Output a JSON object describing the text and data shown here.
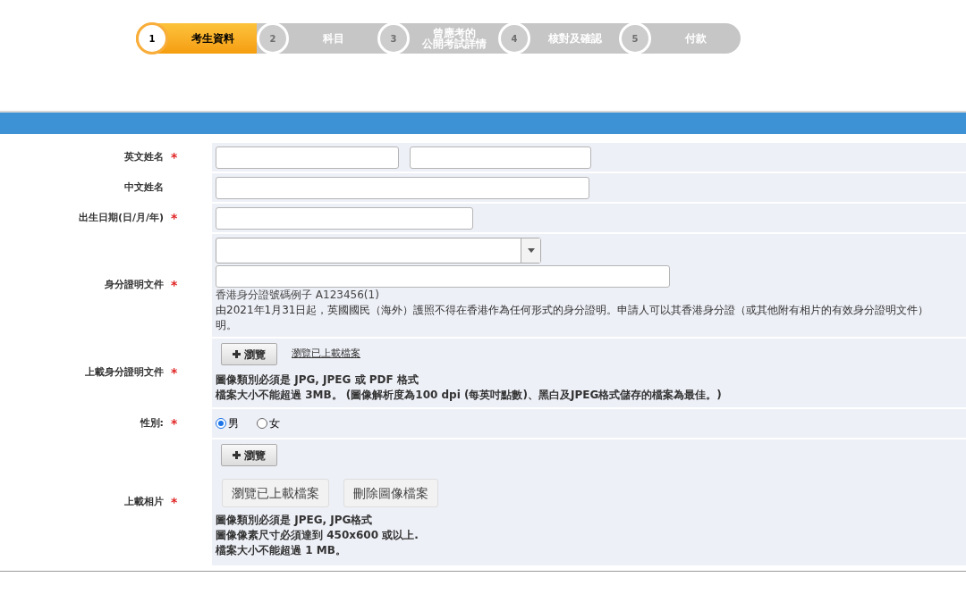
{
  "steps": [
    {
      "number": "1",
      "label": "考生資料",
      "selected": true
    },
    {
      "number": "2",
      "label": "科目",
      "selected": false
    },
    {
      "number": "3",
      "label_lines": [
        "曾應考的",
        "公開考試詳情"
      ],
      "selected": false
    },
    {
      "number": "4",
      "label": "核對及確認",
      "selected": false
    },
    {
      "number": "5",
      "label": "付款",
      "selected": false
    }
  ],
  "form_rows": [
    {
      "label": "英文姓名",
      "required": true,
      "kind": "two_inputs"
    },
    {
      "label": "中文姓名",
      "required": false,
      "kind": "input"
    },
    {
      "label": "出生日期(日/月/年)",
      "required": true,
      "kind": "short_input"
    },
    {
      "label": "身分證明文件",
      "required": true,
      "kind": "id",
      "hint": "香港身分證號碼例子 A123456(1)",
      "notice_lines": [
        "由2021年1月31日起，英國國民（海外）護照不得在香港作為任何形式的身分證明。申請人可以其香港身分證（或其他附有相片的有效身分證明文件）",
        "明。"
      ]
    },
    {
      "label": "上載身分證明文件",
      "required": true,
      "kind": "upload",
      "browse": "瀏覽",
      "link": "瀏覽已上載檔案",
      "notes": [
        "圖像類別必須是 JPG, JPEG 或 PDF 格式",
        "檔案大小不能超過 3MB。 (圖像解析度為100 dpi (每英吋點數)、黑白及JPEG格式儲存的檔案為最佳。)"
      ]
    },
    {
      "label": "性別:",
      "required": true,
      "kind": "radio",
      "options": [
        {
          "label": "男",
          "selected": true
        },
        {
          "label": "女",
          "selected": false
        }
      ]
    },
    {
      "label": "上載相片",
      "required": true,
      "kind": "photo",
      "browse": "瀏覽",
      "buttons": [
        "瀏覽已上載檔案",
        "刪除圖像檔案"
      ],
      "notes": [
        "圖像類別必須是 JPEG, JPG格式",
        "圖像像素尺寸必須達到 450x600 或以上.",
        "檔案大小不能超過 1 MB。"
      ]
    }
  ],
  "required_mark": "*"
}
